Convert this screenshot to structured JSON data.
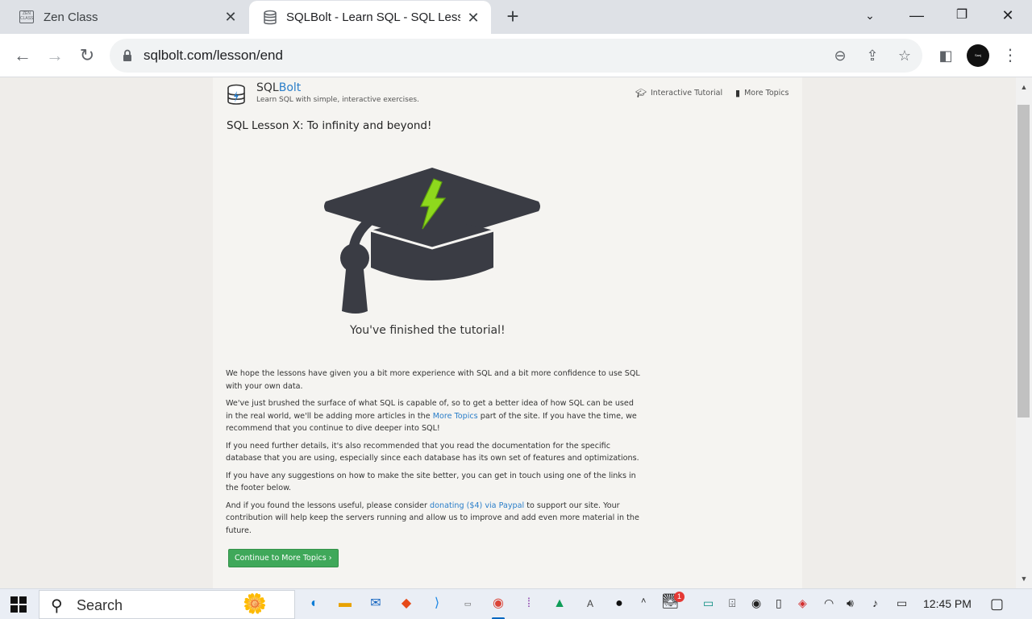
{
  "browser": {
    "tabs": [
      {
        "title": "Zen Class",
        "favicon_text": "ZEN CLASS",
        "active": false
      },
      {
        "title": "SQLBolt - Learn SQL - SQL Lesson X: To infinity and beyond!",
        "active": true
      }
    ],
    "url": "sqlbolt.com/lesson/end",
    "profile_text": "Sanj"
  },
  "site": {
    "name_prefix": "SQL",
    "name_suffix": "Bolt",
    "tagline": "Learn SQL with simple, interactive exercises.",
    "nav": {
      "tutorial": "Interactive Tutorial",
      "topics": "More Topics"
    },
    "lesson_title": "SQL Lesson X: To infinity and beyond!",
    "finished": "You've finished the tutorial!",
    "paragraphs": {
      "p1": "We hope the lessons have given you a bit more experience with SQL and a bit more confidence to use SQL with your own data.",
      "p2_before": "We've just brushed the surface of what SQL is capable of, so to get a better idea of how SQL can be used in the real world, we'll be adding more articles in the ",
      "p2_link": "More Topics",
      "p2_after": " part of the site. If you have the time, we recommend that you continue to dive deeper into SQL!",
      "p3": "If you need further details, it's also recommended that you read the documentation for the specific database that you are using, especially since each database has its own set of features and optimizations.",
      "p4": "If you have any suggestions on how to make the site better, you can get in touch using one of the links in the footer below.",
      "p5_before": "And if you found the lessons useful, please consider ",
      "p5_link": "donating ($4) via Paypal",
      "p5_after": " to support our site. Your contribution will help keep the servers running and allow us to improve and add even more material in the future."
    },
    "continue_button": "Continue to More Topics ›"
  },
  "taskbar": {
    "search_label": "Search",
    "time": "12:45 PM",
    "notification_count": "1"
  },
  "colors": {
    "link": "#2a7ec9",
    "button": "#3fa85a",
    "cap": "#3a3c44",
    "bolt": "#8ed81d"
  }
}
